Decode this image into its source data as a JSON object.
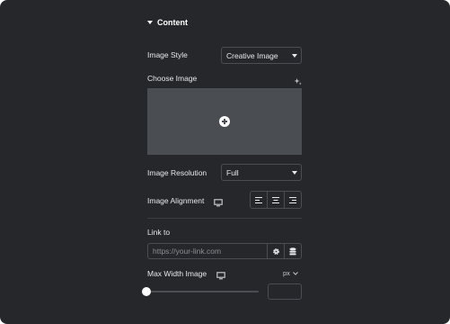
{
  "section": {
    "title": "Content"
  },
  "image_style": {
    "label": "Image Style",
    "value": "Creative Image"
  },
  "choose_image": {
    "label": "Choose Image"
  },
  "image_resolution": {
    "label": "Image Resolution",
    "value": "Full"
  },
  "image_alignment": {
    "label": "Image Alignment",
    "options": [
      "left",
      "center",
      "right"
    ]
  },
  "link": {
    "label": "Link to",
    "placeholder": "https://your-link.com"
  },
  "max_width": {
    "label": "Max Width Image",
    "unit": "px",
    "value": "",
    "slider_value": 0
  },
  "icons": {
    "section_toggle": "caret-down-icon",
    "ai": "sparkle-icon",
    "add_media": "plus-circle-icon",
    "responsive": "desktop-icon",
    "link_options": "gear-icon",
    "dynamic_tags": "database-icon"
  },
  "colors": {
    "panel_bg": "#26272b",
    "control_border": "#4b4d52",
    "media_bg": "#4a4d52",
    "text": "#e6e8ea"
  }
}
